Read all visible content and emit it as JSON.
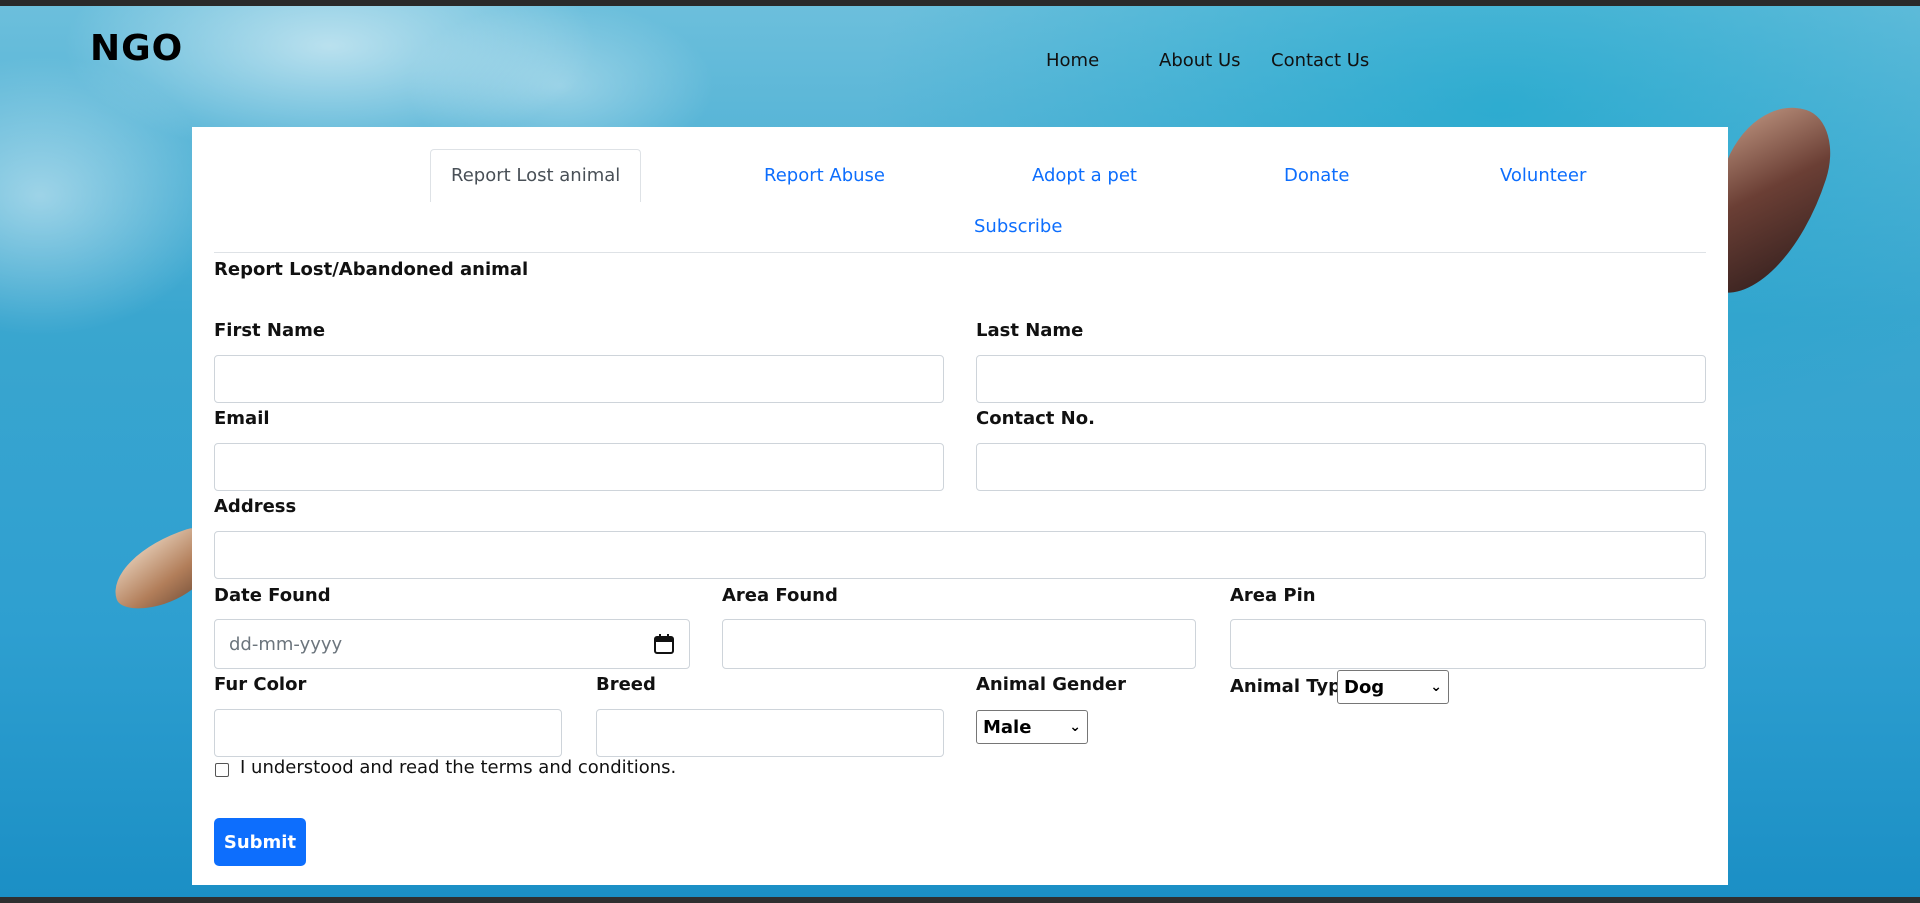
{
  "brand": {
    "name": "NGO"
  },
  "nav": {
    "items": [
      {
        "label": "Home"
      },
      {
        "label": "About Us"
      },
      {
        "label": "Contact Us"
      }
    ]
  },
  "tabs": [
    {
      "label": "Report Lost animal",
      "active": true
    },
    {
      "label": "Report Abuse"
    },
    {
      "label": "Adopt a pet"
    },
    {
      "label": "Donate"
    },
    {
      "label": "Volunteer"
    },
    {
      "label": "Subscribe"
    }
  ],
  "form": {
    "title": "Report Lost/Abandoned animal",
    "fields": {
      "first_name": {
        "label": "First Name",
        "value": ""
      },
      "last_name": {
        "label": "Last Name",
        "value": ""
      },
      "email": {
        "label": "Email",
        "value": ""
      },
      "contact_no": {
        "label": "Contact No.",
        "value": ""
      },
      "address": {
        "label": "Address",
        "value": ""
      },
      "date_found": {
        "label": "Date Found",
        "placeholder": "dd-mm-yyyy"
      },
      "area_found": {
        "label": "Area Found",
        "value": ""
      },
      "area_pin": {
        "label": "Area Pin",
        "value": ""
      },
      "fur_color": {
        "label": "Fur Color",
        "value": ""
      },
      "breed": {
        "label": "Breed",
        "value": ""
      },
      "animal_gender": {
        "label": "Animal Gender",
        "selected": "Male"
      },
      "animal_type": {
        "label": "Animal Type",
        "selected": "Dog"
      }
    },
    "terms": {
      "label": "I understood and read the terms and conditions.",
      "checked": false
    },
    "submit_label": "Submit"
  },
  "colors": {
    "primary": "#0d6efd",
    "tab_active_text": "#495057"
  },
  "icons": {
    "date_picker": "calendar-icon",
    "select_arrow": "chevron-down-icon"
  }
}
